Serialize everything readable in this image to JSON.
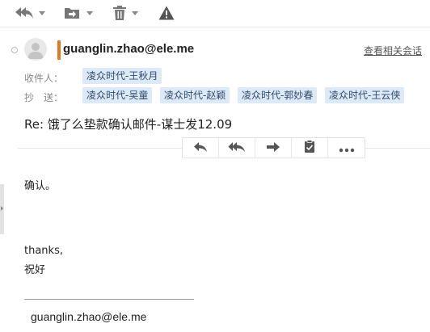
{
  "toolbar": {
    "icons": [
      "reply-all-icon",
      "move-folder-icon",
      "trash-icon",
      "warning-icon"
    ]
  },
  "header": {
    "sender": "guanglin.zhao@ele.me",
    "related_link": "查看相关会话",
    "to_label": "收件人：",
    "to": [
      "凌众时代-王秋月"
    ],
    "cc_label": "抄　送：",
    "cc": [
      "凌众时代-吴童",
      "凌众时代-赵颖",
      "凌众时代-郭妙春",
      "凌众时代-王云侠"
    ]
  },
  "subject": "Re: 饿了么垫款确认邮件-谋士发12.09",
  "actions": [
    "reply-icon",
    "reply-all-icon",
    "forward-icon",
    "clipboard-icon",
    "more-icon"
  ],
  "body": {
    "line1": "确认。",
    "line2": "thanks,",
    "line3": "祝好",
    "signature_email": "guanglin.zhao@ele.me"
  },
  "colors": {
    "accent_bar": "#e8761e",
    "tag_bg": "#dce9f7"
  }
}
